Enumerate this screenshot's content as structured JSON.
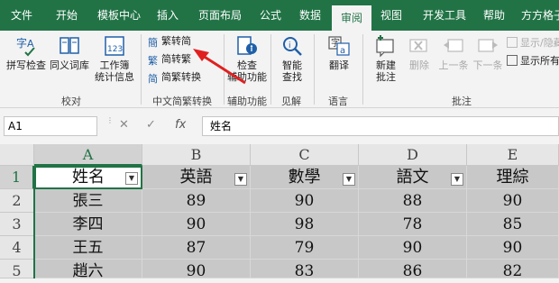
{
  "tabs": [
    "文件",
    "开始",
    "模板中心",
    "插入",
    "页面布局",
    "公式",
    "数据",
    "审阅",
    "视图",
    "开发工具",
    "帮助",
    "方方格子"
  ],
  "active_tab": "审阅",
  "ribbon": {
    "proofing": {
      "spell": "拼写检查",
      "thesaurus": "同义词库",
      "stats_line1": "工作簿",
      "stats_line2": "统计信息",
      "label": "校对"
    },
    "chinese": {
      "to_simplified": "繁转简",
      "to_traditional": "简转繁",
      "convert": "简繁转换",
      "label": "中文简繁转换"
    },
    "accessibility": {
      "check_line1": "检查",
      "check_line2": "辅助功能",
      "label": "辅助功能"
    },
    "insights": {
      "smart_line1": "智能",
      "smart_line2": "查找",
      "label": "见解"
    },
    "language": {
      "translate": "翻译",
      "label": "语言"
    },
    "comments": {
      "new_line1": "新建",
      "new_line2": "批注",
      "delete": "删除",
      "prev": "上一条",
      "next": "下一条",
      "show_hide": "显示/隐藏",
      "show_all": "显示所有",
      "label": "批注"
    }
  },
  "formula_bar": {
    "name_box": "A1",
    "cancel": "✕",
    "confirm": "✓",
    "fx": "fx",
    "formula": "姓名"
  },
  "grid": {
    "columns": [
      "A",
      "B",
      "C",
      "D",
      "E"
    ],
    "rows": [
      "1",
      "2",
      "3",
      "4",
      "5"
    ],
    "header": [
      "姓名",
      "英語",
      "數學",
      "語文",
      "理綜"
    ],
    "data": [
      [
        "張三",
        "89",
        "90",
        "88",
        "90"
      ],
      [
        "李四",
        "90",
        "98",
        "78",
        "85"
      ],
      [
        "王五",
        "87",
        "79",
        "90",
        "90"
      ],
      [
        "趙六",
        "90",
        "83",
        "86",
        "82"
      ]
    ]
  },
  "colors": {
    "brand": "#217346",
    "arrow": "#e02020"
  }
}
